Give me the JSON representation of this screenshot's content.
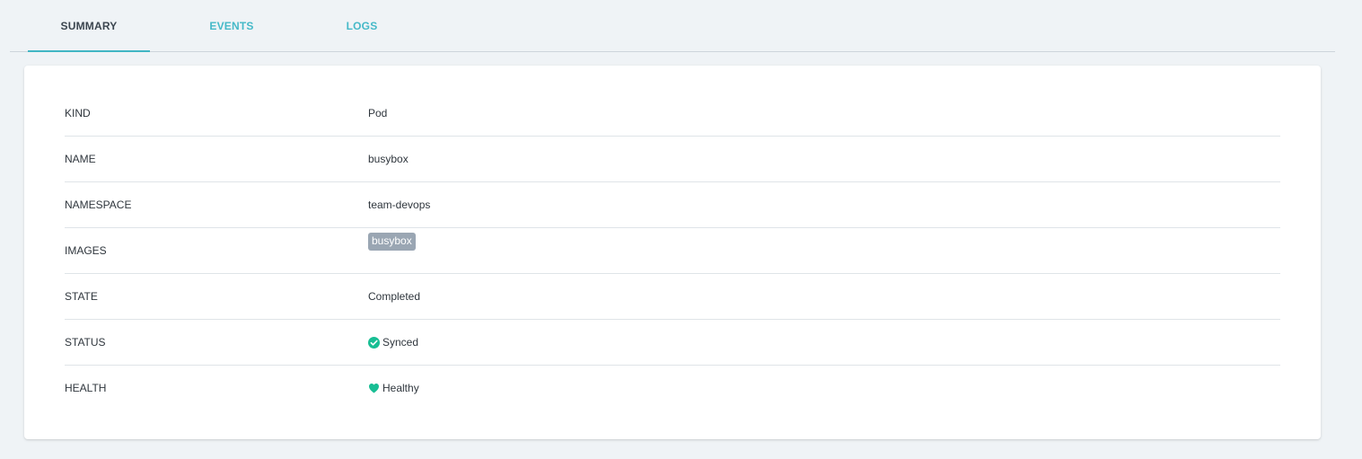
{
  "tabs": {
    "summary": "SUMMARY",
    "events": "EVENTS",
    "logs": "LOGS"
  },
  "summary": {
    "rows": [
      {
        "label": "KIND",
        "value": "Pod"
      },
      {
        "label": "NAME",
        "value": "busybox"
      },
      {
        "label": "NAMESPACE",
        "value": "team-devops"
      },
      {
        "label": "IMAGES",
        "value": "busybox"
      },
      {
        "label": "STATE",
        "value": "Completed"
      },
      {
        "label": "STATUS",
        "value": "Synced"
      },
      {
        "label": "HEALTH",
        "value": "Healthy"
      }
    ]
  },
  "icons": {
    "status": "check-circle-icon",
    "health": "heart-icon"
  },
  "colors": {
    "accent": "#45b9c8",
    "success": "#18be94",
    "chip": "#9aa6b3"
  }
}
